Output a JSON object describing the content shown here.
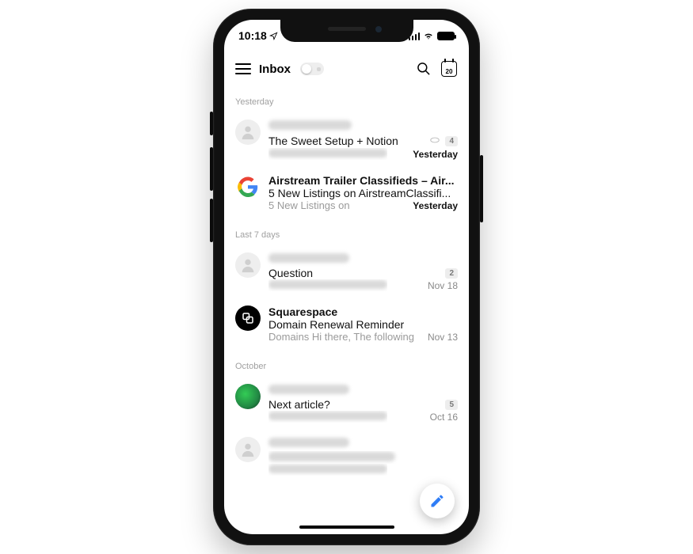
{
  "statusBar": {
    "time": "10:18",
    "calendarDay": "20"
  },
  "header": {
    "title": "Inbox"
  },
  "sections": [
    {
      "title": "Yesterday",
      "rows": [
        {
          "senderRedacted": true,
          "sender": "Francesco, Mike",
          "subject": "The Sweet Setup + Notion",
          "hasAttachment": true,
          "badge": "4",
          "preview": "Hi Josh, Thank you for the",
          "previewRedacted": true,
          "time": "Yesterday",
          "timeStrong": true,
          "avatar": "default",
          "senderBold": false
        },
        {
          "senderRedacted": false,
          "sender": "Airstream Trailer Classifieds – Air...",
          "subject": "5 New Listings on AirstreamClassifi...",
          "hasAttachment": false,
          "badge": "",
          "preview": "5 New Listings on",
          "previewRedacted": false,
          "time": "Yesterday",
          "timeStrong": true,
          "avatar": "google",
          "senderBold": true
        }
      ]
    },
    {
      "title": "Last 7 days",
      "rows": [
        {
          "senderRedacted": true,
          "sender": "Karlin Krieger",
          "subject": "Question",
          "badge": "2",
          "hasAttachment": false,
          "preview": "Good day Mr Krieger! Long time",
          "previewRedacted": true,
          "time": "Nov 18",
          "timeStrong": false,
          "avatar": "default",
          "senderBold": false
        },
        {
          "senderRedacted": false,
          "sender": "Squarespace",
          "subject": "Domain Renewal Reminder",
          "badge": "",
          "hasAttachment": false,
          "preview": "Domains Hi there, The following",
          "previewRedacted": false,
          "time": "Nov 13",
          "timeStrong": false,
          "avatar": "sq",
          "senderBold": true
        }
      ]
    },
    {
      "title": "October",
      "rows": [
        {
          "senderRedacted": true,
          "sender": "Curtis Michale",
          "subject": "Next article?",
          "badge": "5",
          "hasAttachment": false,
          "preview": "I think that should be a fine",
          "previewRedacted": true,
          "time": "Oct 16",
          "timeStrong": false,
          "avatar": "photo",
          "senderBold": false
        },
        {
          "senderRedacted": true,
          "sender": "kelsey mahoney",
          "subject": "2018-2019 Manitoba U18 AAA",
          "subjectRedacted": true,
          "badge": "",
          "hasAttachment": false,
          "preview": "Gentlemen, As requested here is",
          "previewRedacted": true,
          "time": "",
          "timeStrong": false,
          "avatar": "default",
          "senderBold": false
        }
      ]
    }
  ]
}
